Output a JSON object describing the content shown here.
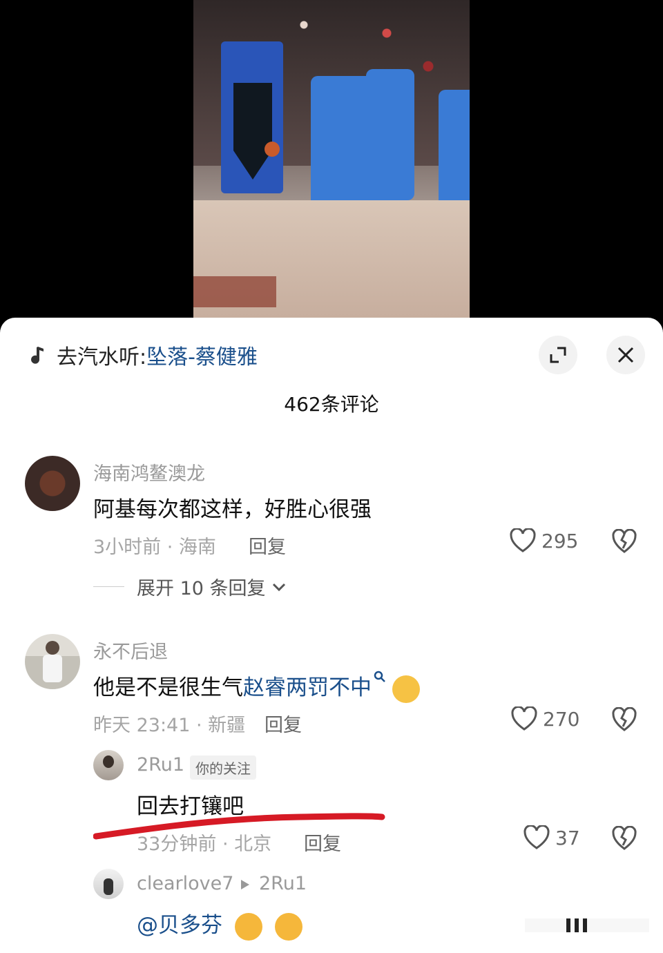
{
  "music": {
    "prefix": "去汽水听:",
    "song": "坠落-蔡健雅"
  },
  "comments_count": "462条评论",
  "comments": [
    {
      "username": "海南鸿鳌澳龙",
      "text": "阿基每次都这样，好胜心很强",
      "time_location": "3小时前 · 海南",
      "reply_label": "回复",
      "likes": "295",
      "expand_label": "展开 10 条回复"
    },
    {
      "username": "永不后退",
      "text_prefix": "他是不是很生气",
      "text_link": "赵睿两罚不中",
      "time_location": "昨天 23:41 · 新疆",
      "reply_label": "回复",
      "likes": "270"
    }
  ],
  "replies": [
    {
      "username": "2Ru1",
      "tag": "你的关注",
      "text": "回去打镶吧",
      "time_location": "33分钟前 · 北京",
      "reply_label": "回复",
      "likes": "37"
    },
    {
      "username": "clearlove7",
      "reply_to": "2Ru1",
      "text": "@贝多芬"
    }
  ],
  "colors": {
    "link": "#1a4f8b",
    "annotation": "#d61a25"
  },
  "icons": [
    "music-note-icon",
    "expand-icon",
    "close-icon",
    "heart-icon",
    "broken-heart-icon",
    "search-mark-icon",
    "chevron-down-icon"
  ]
}
